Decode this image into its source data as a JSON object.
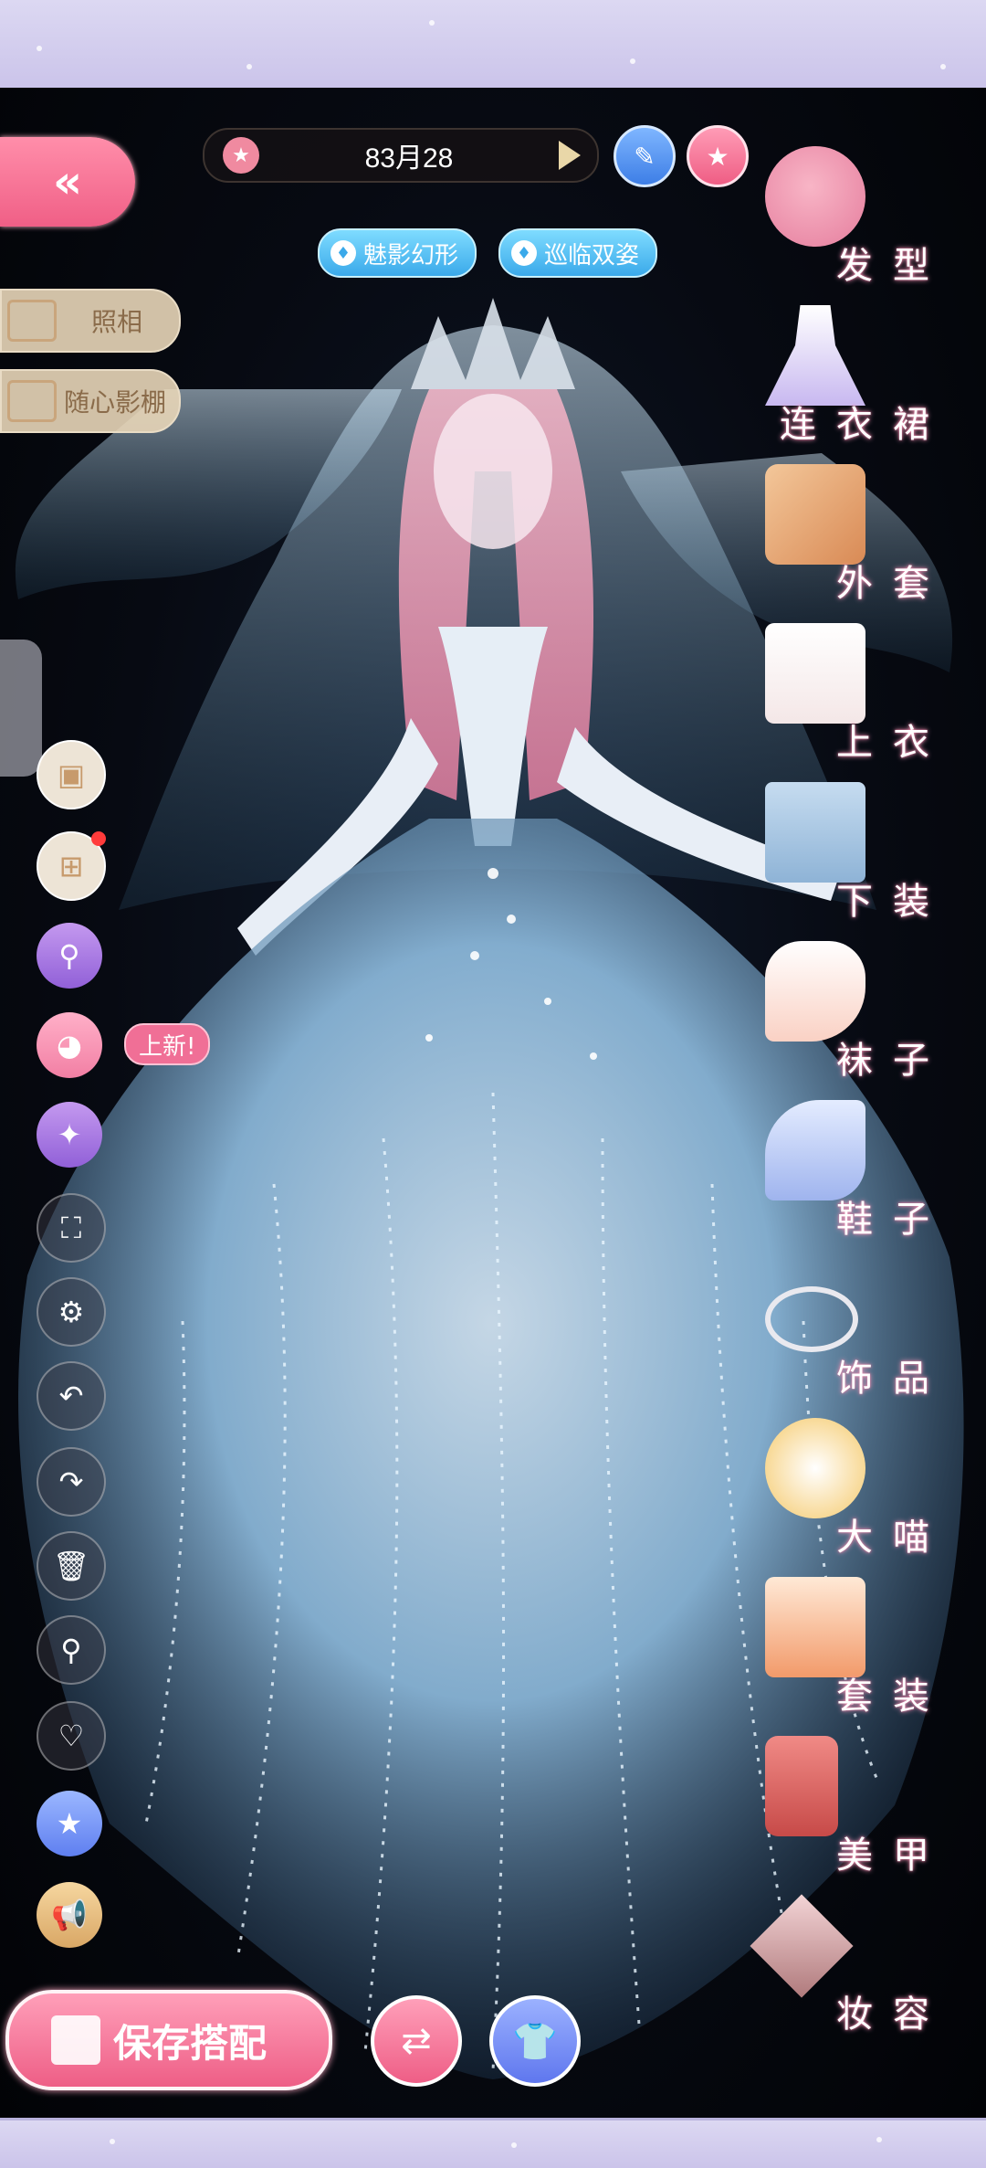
{
  "header": {
    "date": "83月28",
    "tags": [
      {
        "label": "魅影幻形"
      },
      {
        "label": "巡临双姿"
      }
    ]
  },
  "left_menu": {
    "photo_label": "照相",
    "studio_label": "随心影棚",
    "new_badge": "上新!"
  },
  "categories": [
    {
      "label": "发型",
      "icon": "hair-icon"
    },
    {
      "label": "连衣裙",
      "icon": "dress-icon"
    },
    {
      "label": "外套",
      "icon": "coat-icon"
    },
    {
      "label": "上衣",
      "icon": "top-icon"
    },
    {
      "label": "下装",
      "icon": "bottom-icon"
    },
    {
      "label": "袜子",
      "icon": "sock-icon"
    },
    {
      "label": "鞋子",
      "icon": "shoe-icon"
    },
    {
      "label": "饰品",
      "icon": "accessory-icon"
    },
    {
      "label": "大喵",
      "icon": "cat-icon"
    },
    {
      "label": "套装",
      "icon": "suit-icon"
    },
    {
      "label": "美甲",
      "icon": "nail-polish-icon"
    },
    {
      "label": "妆容",
      "icon": "makeup-icon"
    }
  ],
  "bottom": {
    "save_label": "保存搭配"
  },
  "colors": {
    "accent_pink": "#f06f96",
    "accent_blue": "#3aa9ea",
    "band": "#cbc4ea",
    "label_glow": "#ff9fc0"
  }
}
